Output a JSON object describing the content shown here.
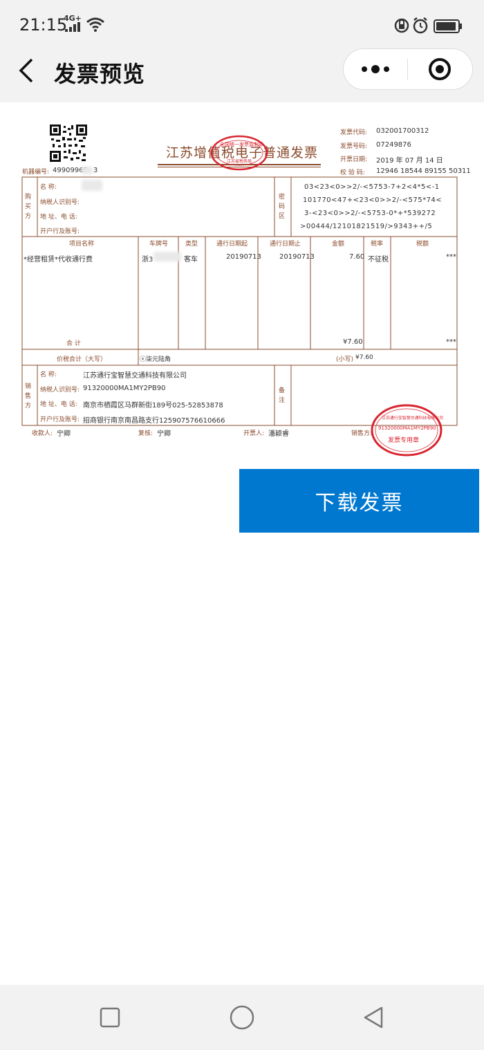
{
  "status_bar": {
    "time": "21:15",
    "network": "4G+"
  },
  "nav": {
    "title": "发票预览"
  },
  "invoice": {
    "title": "江苏增值税电子普通发票",
    "machine_no_label": "机器编号:",
    "machine_no": "49909965",
    "machine_no_tail": "3",
    "header_fields": [
      {
        "label": "发票代码:",
        "value": "032001700312"
      },
      {
        "label": "发票号码:",
        "value": "07249876"
      },
      {
        "label": "开票日期:",
        "value": "2019 年 07 月 14 日"
      },
      {
        "label": "校 验 码:",
        "value": "12946 18544 89155 50311"
      }
    ],
    "buyer_side": "购买方",
    "buyer_labels": [
      "名 称:",
      "纳税人识别号:",
      "地 址、电 话:",
      "开户行及账号:"
    ],
    "cipher_label": "密码区",
    "cipher_lines": [
      "03<23<0>>2/-<5753-7+2<4*5<-1",
      "101770<47+<23<0>>2/-<575*74<",
      "3-<23<0>>2/-<5753-0*+*539272",
      ">00444/12101821519/>9343++/5"
    ],
    "columns": [
      "项目名称",
      "车牌号",
      "类型",
      "通行日期起",
      "通行日期止",
      "金额",
      "税率",
      "税额"
    ],
    "row": {
      "name": "*经营租赁*代收通行费",
      "plate": "浙3",
      "type": "客车",
      "start": "20190713",
      "end": "20190713",
      "amount": "7.60",
      "rate": "不征税",
      "tax": "***"
    },
    "total_label": "合 计",
    "total_amount": "¥7.60",
    "total_tax": "***",
    "total_words_label": "价税合计（大写）",
    "total_words": "ⓧ柒元陆角",
    "lower_label": "(小写)",
    "lower_value": "¥7.60",
    "seller_side": "销售方",
    "seller_labels": [
      "名 称:",
      "纳税人识别号:",
      "地 址、电 话:",
      "开户行及账号:"
    ],
    "seller_values": [
      "江苏通行宝智慧交通科技有限公司",
      "91320000MA1MY2PB90",
      "南京市栖霞区马群新街189号025-52853878",
      "招商银行南京南昌路支行125907576610666"
    ],
    "remarks_label": "备注",
    "footer": [
      {
        "label": "收款人:",
        "value": "宁卿"
      },
      {
        "label": "复核:",
        "value": "宁卿"
      },
      {
        "label": "开票人:",
        "value": "潘颖睿"
      },
      {
        "label": "销售方:",
        "value": ""
      }
    ],
    "seal_top_line": "全国统一发票监制章",
    "seal_top_bottom": "江苏省税务局",
    "seal_right_ring": "江苏通行宝智慧交通科技有限公司",
    "seal_right_code": "91320000MA1MY2PB90",
    "seal_right_label": "发票专用章"
  },
  "download_button": "下载发票",
  "colors": {
    "brand_blue": "#0078d0",
    "invoice_brown": "#8a4b2c",
    "seal_red": "#d8252f"
  }
}
